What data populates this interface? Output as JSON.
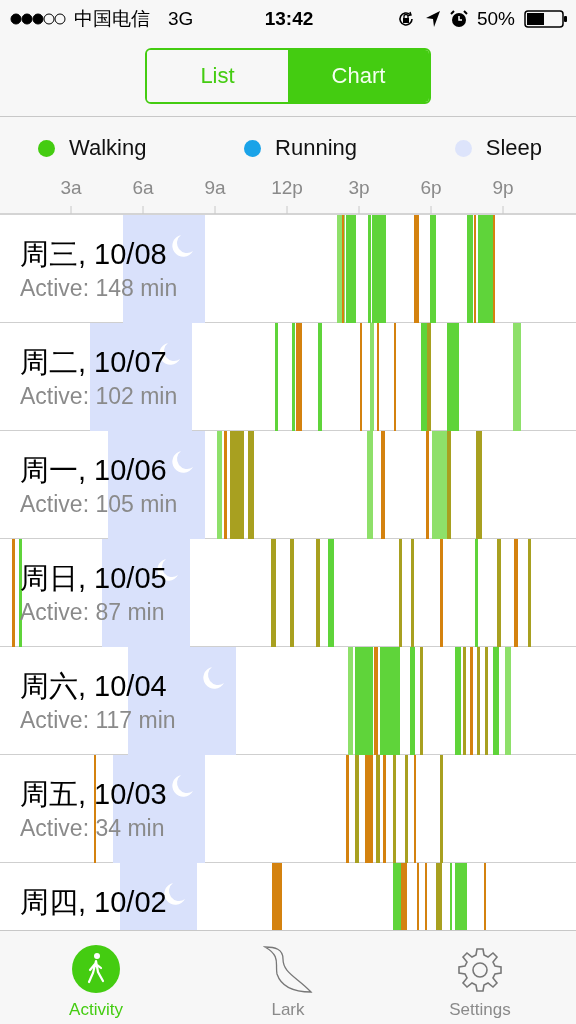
{
  "status_bar": {
    "carrier": "中国电信",
    "network": "3G",
    "time": "13:42",
    "battery": "50%"
  },
  "segmented": [
    {
      "label": "List",
      "selected": false
    },
    {
      "label": "Chart",
      "selected": true
    }
  ],
  "legend": [
    {
      "label": "Walking",
      "color": "#44cc11"
    },
    {
      "label": "Running",
      "color": "#1aa3e8"
    },
    {
      "label": "Sleep",
      "color": "#dde4fb"
    }
  ],
  "axis_labels": [
    "3a",
    "6a",
    "9a",
    "12p",
    "3p",
    "6p",
    "9p"
  ],
  "days": [
    {
      "date": "周三, 10/08",
      "active": "Active: 148 min"
    },
    {
      "date": "周二, 10/07",
      "active": "Active: 102 min"
    },
    {
      "date": "周一, 10/06",
      "active": "Active: 105 min"
    },
    {
      "date": "周日, 10/05",
      "active": "Active: 87 min"
    },
    {
      "date": "周六, 10/04",
      "active": "Active: 117 min"
    },
    {
      "date": "周五, 10/03",
      "active": "Active: 34 min"
    },
    {
      "date": "周四, 10/02"
    }
  ],
  "tab_bar": [
    {
      "kind": "activity",
      "label": "Activity",
      "selected": true
    },
    {
      "kind": "lark",
      "label": "Lark",
      "selected": false
    },
    {
      "kind": "settings",
      "label": "Settings",
      "selected": false
    }
  ]
}
